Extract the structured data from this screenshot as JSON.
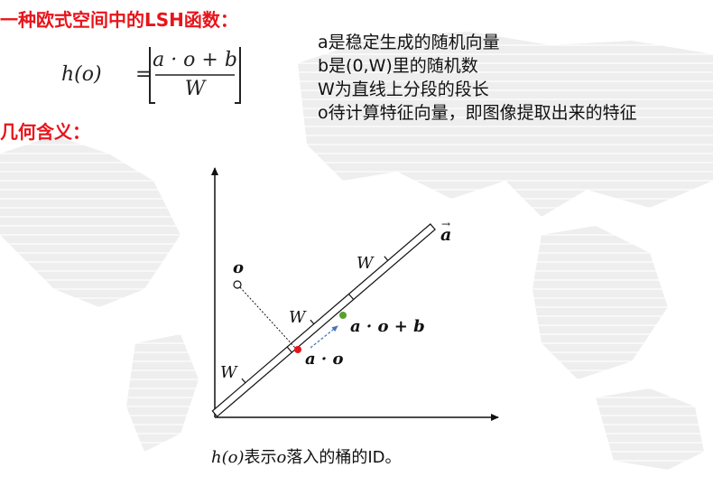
{
  "title": "一种欧式空间中的LSH函数：",
  "subtitle": "几何含义：",
  "formula": {
    "lhs": "h(o)",
    "equals": "=",
    "numerator": "a · o + b",
    "denominator": "W"
  },
  "definitions": [
    "a是稳定生成的随机向量",
    "b是(0,W)里的随机数",
    "W为直线上分段的段长",
    "o待计算特征向量，即图像提取出来的特征"
  ],
  "diagram": {
    "vector_label": "a",
    "point_label": "o",
    "segment_labels": [
      "W",
      "W",
      "W"
    ],
    "projection_label": "a · o",
    "shifted_label": "a · o + b",
    "colors": {
      "projection_point": "#e8141b",
      "shifted_point": "#5aa02c",
      "arrow": "#4a72b8",
      "heading": "#e8141b"
    }
  },
  "caption": {
    "math": "h(o)",
    "text_1": "表示",
    "math_o": "o",
    "text_2": "落入的桶的ID。"
  }
}
